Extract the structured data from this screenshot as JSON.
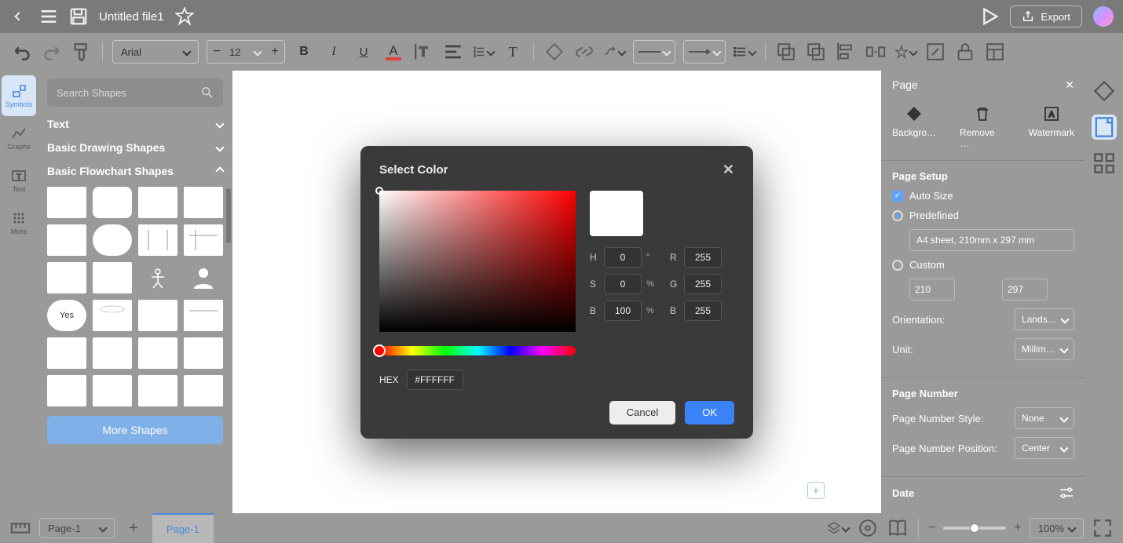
{
  "titlebar": {
    "filename": "Untitled file1",
    "export": "Export"
  },
  "toolbar": {
    "font": "Arial",
    "fontsize": "12"
  },
  "left_strip": {
    "symbols": "Symbols",
    "graphs": "Graphs",
    "text": "Text",
    "more": "More"
  },
  "shapes": {
    "search_placeholder": "Search Shapes",
    "cat_text": "Text",
    "cat_basic_drawing": "Basic Drawing Shapes",
    "cat_flowchart": "Basic Flowchart Shapes",
    "more_shapes": "More Shapes",
    "yes_label": "Yes"
  },
  "modal": {
    "title": "Select Color",
    "h_label": "H",
    "h_val": "0",
    "h_unit": "°",
    "s_label": "S",
    "s_val": "0",
    "s_unit": "%",
    "v_label": "B",
    "v_val": "100",
    "v_unit": "%",
    "r_label": "R",
    "r_val": "255",
    "g_label": "G",
    "g_val": "255",
    "b_label": "B",
    "b_val": "255",
    "hex_label": "HEX",
    "hex_val": "#FFFFFF",
    "cancel": "Cancel",
    "ok": "OK"
  },
  "right": {
    "page_title": "Page",
    "tab_background": "Backgro…",
    "tab_remove": "Remove …",
    "tab_watermark": "Watermark",
    "page_setup": "Page Setup",
    "auto_size": "Auto Size",
    "predefined": "Predefined",
    "predefined_value": "A4 sheet, 210mm x 297 mm",
    "custom": "Custom",
    "custom_w": "210",
    "custom_h": "297",
    "orientation_label": "Orientation:",
    "orientation_value": "Lands…",
    "unit_label": "Unit:",
    "unit_value": "Millim…",
    "page_number": "Page Number",
    "pn_style_label": "Page Number Style:",
    "pn_style_value": "None",
    "pn_pos_label": "Page Number Position:",
    "pn_pos_value": "Center",
    "date": "Date"
  },
  "bottom": {
    "page_dd": "Page-1",
    "page_tab": "Page-1",
    "zoom": "100%"
  }
}
